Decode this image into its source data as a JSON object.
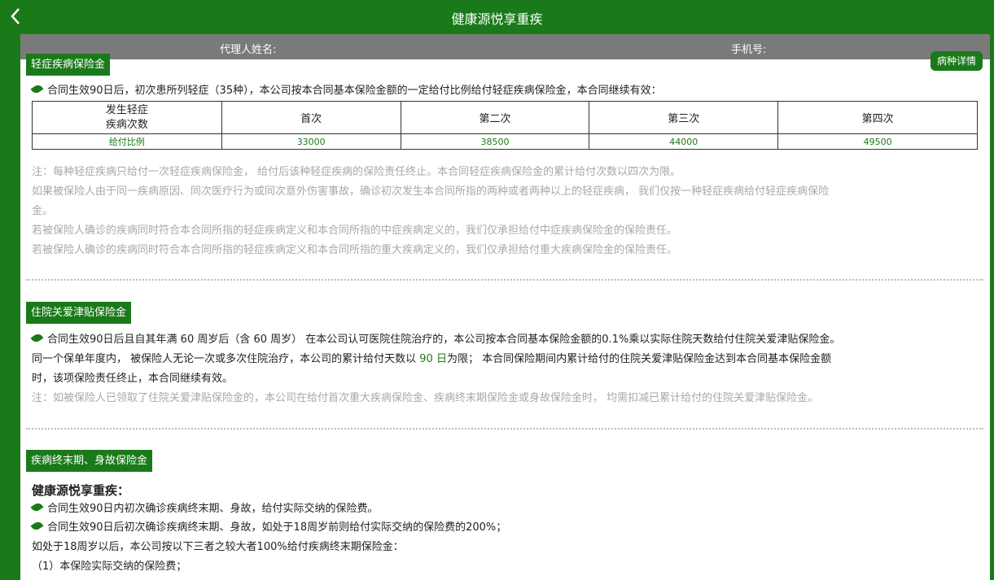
{
  "header": {
    "title": "健康源悦享重疾"
  },
  "agent_bar": {
    "agent_label": "代理人姓名:",
    "phone_label": "手机号:"
  },
  "detail_button": "病种详情",
  "section1": {
    "tag": "轻症疾病保险金",
    "intro": "合同生效90日后，初次患所列轻症（35种），本公司按本合同基本保险金额的一定给付比例给付轻症疾病保险金，本合同继续有效：",
    "table": {
      "header_cell": "发生轻症\n疾病次数",
      "columns": [
        "首次",
        "第二次",
        "第三次",
        "第四次"
      ],
      "row_label": "给付比例",
      "values": [
        "33000",
        "38500",
        "44000",
        "49500"
      ]
    },
    "notes": [
      "注：每种轻症疾病只给付一次轻症疾病保险金，  给付后该种轻症疾病的保险责任终止。本合同轻症疾病保险金的累计给付次数以四次为限。",
      "如果被保险人由于同一疾病原因、同次医疗行为或同次意外伤害事故，确诊初次发生本合同所指的两种或者两种以上的轻症疾病，  我们仅按一种轻症疾病给付轻症疾病保险",
      "金。",
      "若被保险人确诊的疾病同时符合本合同所指的轻症疾病定义和本合同所指的中症疾病定义的，我们仅承担给付中症疾病保险金的保险责任。",
      "若被保险人确诊的疾病同时符合本合同所指的轻症疾病定义和本合同所指的重大疾病定义的，我们仅承担给付重大疾病保险金的保险责任。"
    ]
  },
  "section2": {
    "tag": "住院关爱津贴保险金",
    "line1": "合同生效90日后且自其年满 60 周岁后（含 60 周岁） 在本公司认可医院住院治疗的，本公司按本合同基本保险金额的0.1%乘以实际住院天数给付住院关爱津贴保险金。",
    "line2_pre": "同一个保单年度内，  被保险人无论一次或多次住院治疗，本公司的累计给付天数以 ",
    "line2_days": "90 日",
    "line2_post": "为限；  本合同保险期间内累计给付的住院关爱津贴保险金达到本合同基本保险金额",
    "line3": "时，该项保险责任终止，本合同继续有效。",
    "note": "注：如被保险人已领取了住院关爱津贴保险金的，本公司在给付首次重大疾病保险金、疾病终末期保险金或身故保险金时，  均需扣减已累计给付的住院关爱津贴保险金。"
  },
  "section3": {
    "tag": "疾病终末期、身故保险金",
    "heading": "健康源悦享重疾：",
    "items": [
      "合同生效90日内初次确诊疾病终末期、身故，给付实际交纳的保险费。",
      "合同生效90日后初次确诊疾病终末期、身故，如处于18周岁前则给付实际交纳的保险费的200%；"
    ],
    "line": "如处于18周岁以后，本公司按以下三者之较大者100%给付疾病终末期保险金：",
    "sub": "（1）本保险实际交纳的保险费；"
  }
}
